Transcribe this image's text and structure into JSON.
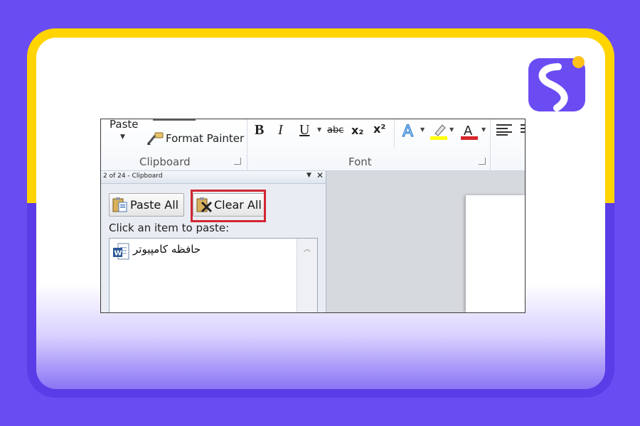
{
  "ribbon": {
    "paste_label": "Paste",
    "format_painter_label": "Format Painter",
    "clipboard_group_label": "Clipboard",
    "font_group_label": "Font",
    "bold_label": "B",
    "italic_label": "I",
    "underline_label": "U",
    "strikethrough_label": "abc",
    "subscript_label": "x₂",
    "superscript_label": "x²"
  },
  "clipboard_pane": {
    "title": "2 of 24 - Clipboard",
    "paste_all_label": "Paste All",
    "clear_all_label": "Clear All",
    "hint": "Click an item to paste:",
    "items": [
      {
        "text": "حافظه کامپیوتر",
        "icon": "word-doc-icon"
      }
    ]
  },
  "colors": {
    "background": "#6a4cf3",
    "frame_accent": "#ffd400",
    "highlight": "#d22630",
    "font_color_bar": "#d7262b",
    "highlight_color_bar": "#ffff00"
  }
}
